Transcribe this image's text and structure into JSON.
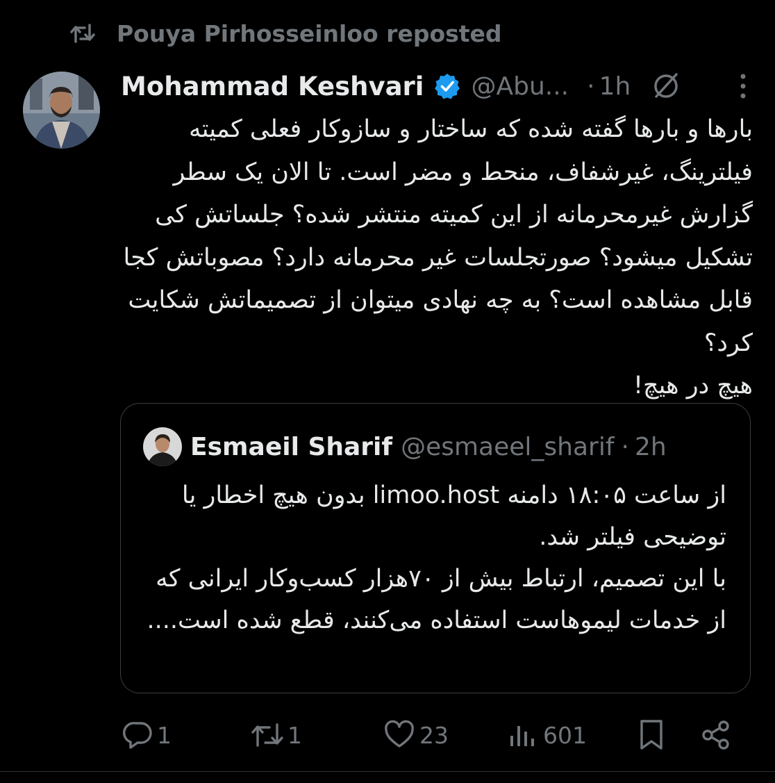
{
  "repost": {
    "icon": "repost-icon",
    "label": "Pouya Pirhosseinloo reposted"
  },
  "tweet": {
    "author_name": "Mohammad Keshvari",
    "author_handle": "@Abu...",
    "time_separator": "·",
    "time": "1h",
    "text": "بارها و بارها گفته شده که ساختار و سازوکار فعلی کمیته فیلترینگ، غیرشفاف، منحط و مضر است. تا الان یک سطر گزارش غیرمحرمانه از این کمیته منتشر شده؟ جلساتش کی تشکیل میشود؟ صورتجلسات غیر محرمانه دارد؟ مصوباتش کجا قابل مشاهده است؟ به چه نهادی میتوان از تصمیماتش شکایت کرد؟\nهیچ در هیچ!",
    "colors": {
      "verified": "#1d9bf0",
      "text": "#e7e9ea",
      "muted": "#71767b",
      "background": "#000000"
    }
  },
  "quote": {
    "author_name": "Esmaeil Sharif",
    "author_handle": "@esmaeel_sharif",
    "time_separator": "·",
    "time": "2h",
    "text": "از ساعت ۱۸:۰۵ دامنه  limoo.host بدون هیچ اخطار یا توضیحی فیلتر شد.\nبا این تصمیم، ارتباط بیش از ۷۰هزار کسب‌وکار ایرانی که از خدمات لیموهاست استفاده می‌کنند، قطع شده است...."
  },
  "actions": {
    "reply": {
      "icon": "reply-icon",
      "count": "1"
    },
    "repost": {
      "icon": "repost-icon",
      "count": "1"
    },
    "like": {
      "icon": "heart-icon",
      "count": "23"
    },
    "views": {
      "icon": "views-icon",
      "count": "601"
    },
    "bookmark": {
      "icon": "bookmark-icon"
    },
    "share": {
      "icon": "share-icon"
    }
  }
}
